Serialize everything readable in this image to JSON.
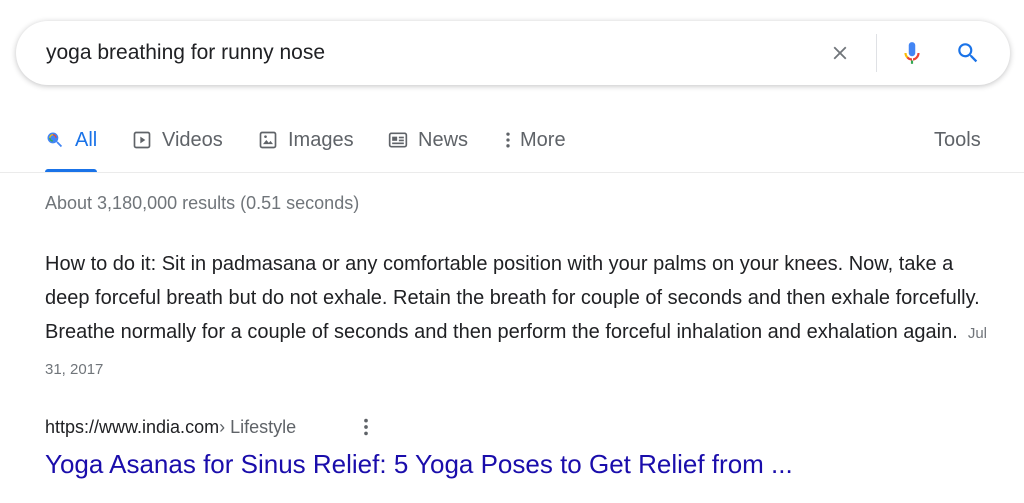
{
  "search": {
    "query": "yoga breathing for runny nose"
  },
  "icons": {
    "clear": "close-icon",
    "mic": "microphone-icon",
    "search": "search-icon"
  },
  "tabs": [
    {
      "label": "All",
      "icon": "search-icon",
      "active": true
    },
    {
      "label": "Videos",
      "icon": "play-icon"
    },
    {
      "label": "Images",
      "icon": "image-icon"
    },
    {
      "label": "News",
      "icon": "news-icon"
    },
    {
      "label": "More",
      "icon": "more-vert-icon"
    }
  ],
  "tools_label": "Tools",
  "result_stats": "About 3,180,000 results (0.51 seconds)",
  "featured_snippet": {
    "text": "How to do it: Sit in padmasana or any comfortable position with your palms on your knees. Now, take a deep forceful breath but do not exhale. Retain the breath for couple of seconds and then exhale forcefully. Breathe normally for a couple of seconds and then perform the forceful inhalation and exhalation again.",
    "date": "Jul 31, 2017"
  },
  "result": {
    "url": "https://www.india.com",
    "breadcrumb": " › Lifestyle",
    "title": "Yoga Asanas for Sinus Relief: 5 Yoga Poses to Get Relief from ..."
  },
  "colors": {
    "link": "#1a0dab",
    "accent": "#1a73e8",
    "muted": "#70757a"
  }
}
